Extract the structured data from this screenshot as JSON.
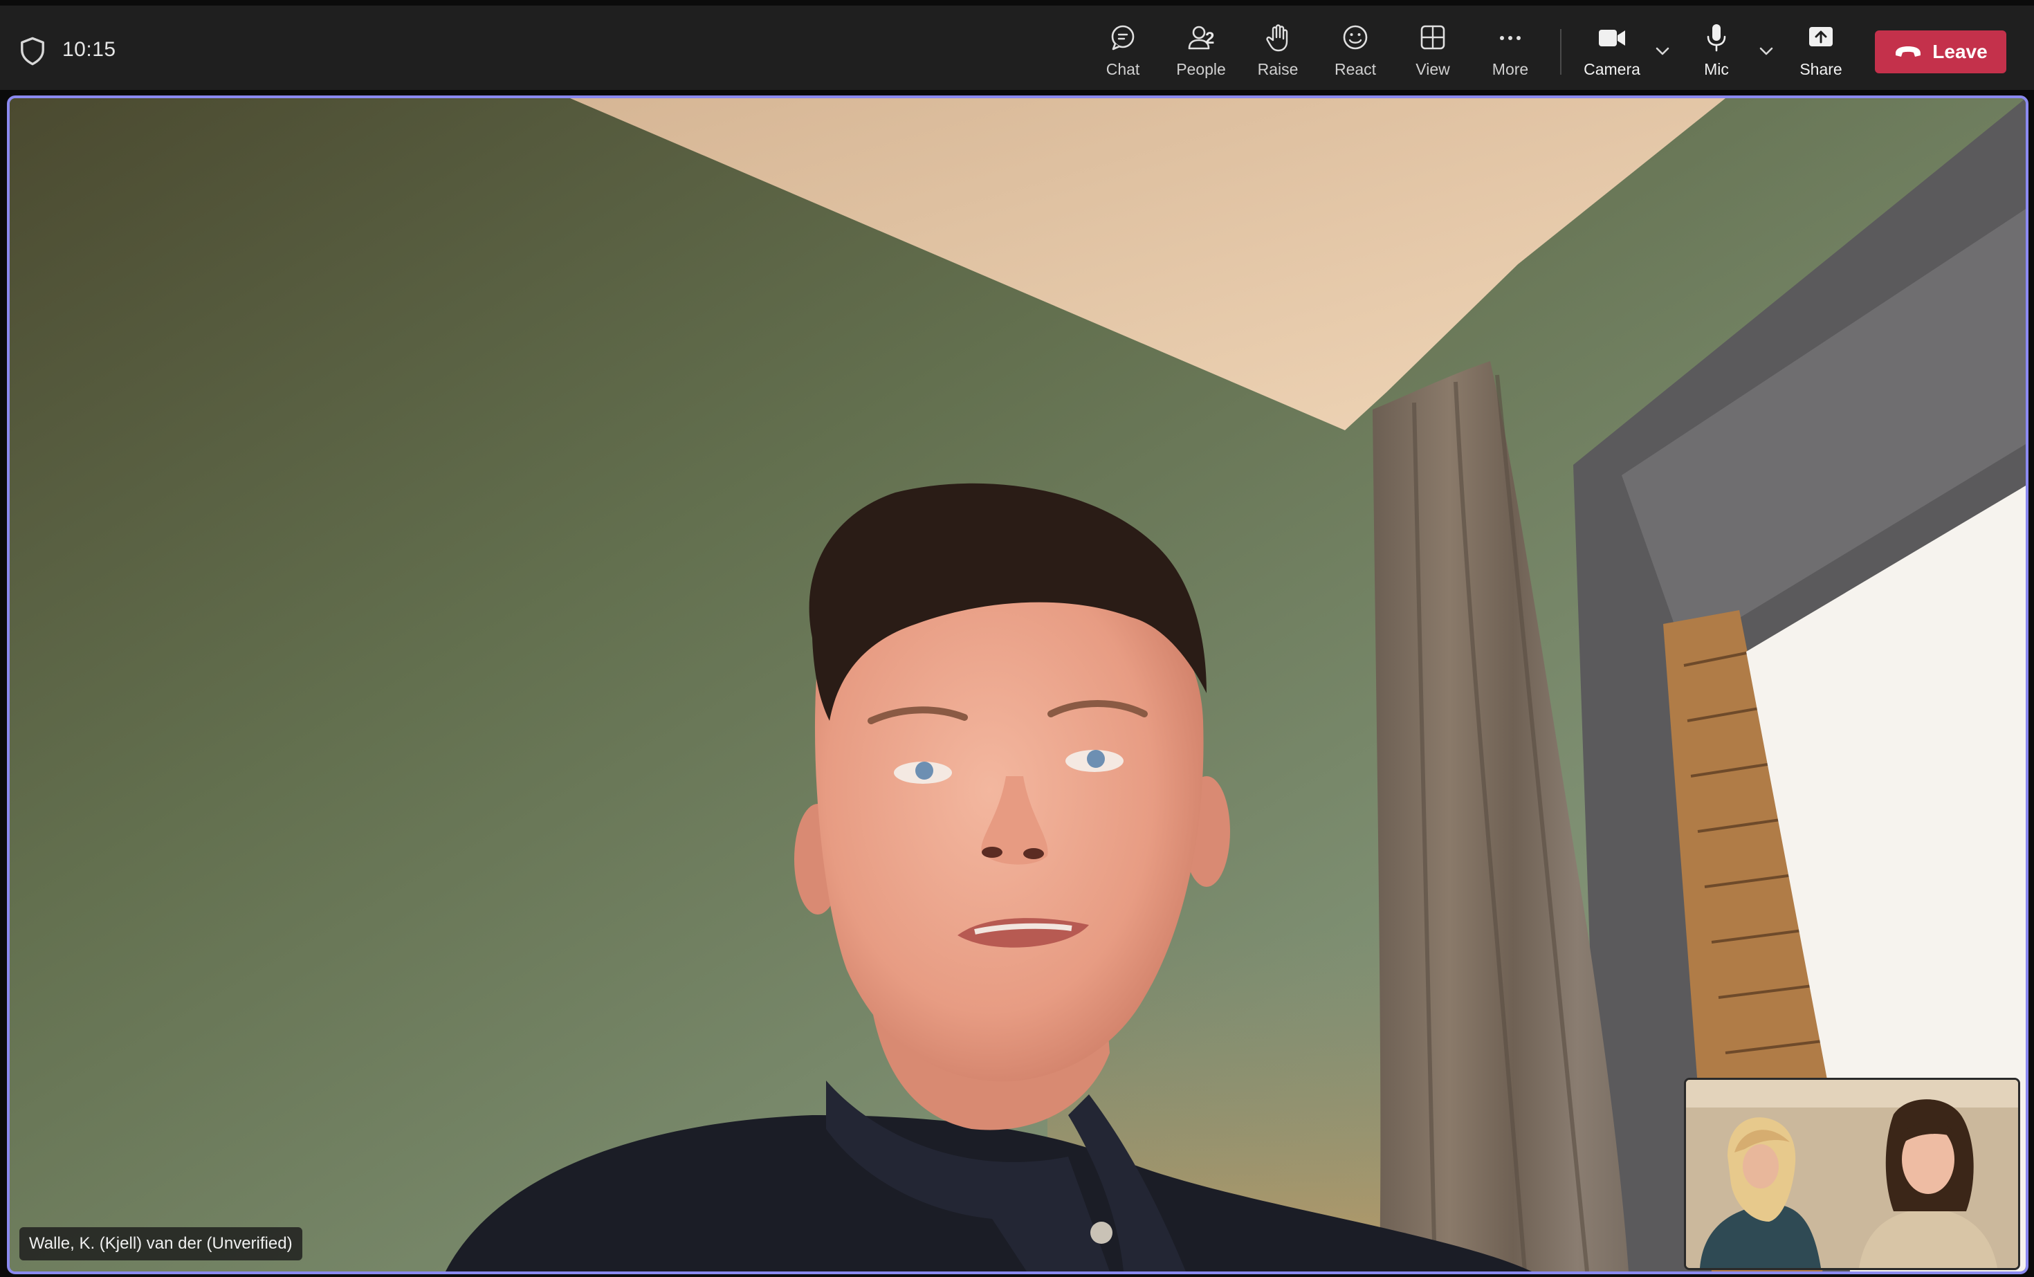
{
  "header": {
    "time": "10:15",
    "people_count": "2",
    "buttons": {
      "chat": "Chat",
      "people": "People",
      "raise": "Raise",
      "react": "React",
      "view": "View",
      "more": "More",
      "camera": "Camera",
      "mic": "Mic",
      "share": "Share",
      "leave": "Leave"
    }
  },
  "stage": {
    "participant_name": "Walle, K. (Kjell) van der (Unverified)"
  },
  "colors": {
    "accent_border": "#8b8af0",
    "leave_red": "#c4314b",
    "toolbar_bg": "#1f1f1f"
  }
}
